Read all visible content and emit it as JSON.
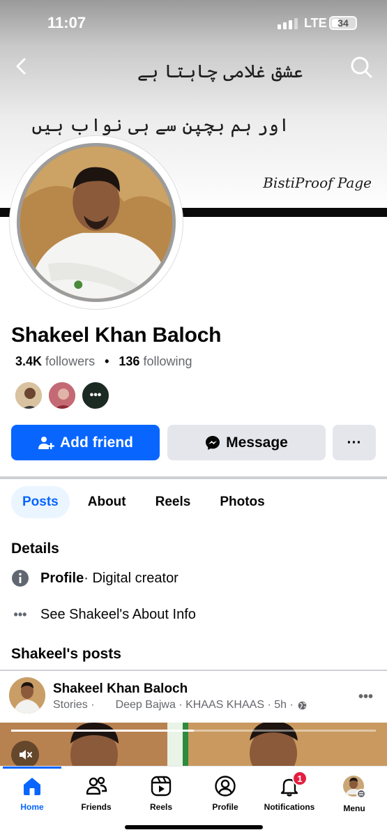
{
  "status_bar": {
    "time": "11:07",
    "network": "LTE",
    "battery": "34",
    "battery_fraction": 0.34
  },
  "cover": {
    "line1": "عشق غلامی چاہتا ہے",
    "line2": "اور ہم بچپن سے ہی نواب ہیں",
    "watermark": "BistiProof Page"
  },
  "profile": {
    "name": "Shakeel Khan Baloch",
    "followers_count": "3.4K",
    "followers_label": "followers",
    "following_count": "136",
    "following_label": "following"
  },
  "actions": {
    "add_friend": "Add friend",
    "message": "Message",
    "more": "···"
  },
  "tabs": [
    {
      "label": "Posts",
      "active": true
    },
    {
      "label": "About"
    },
    {
      "label": "Reels"
    },
    {
      "label": "Photos"
    }
  ],
  "details": {
    "title": "Details",
    "profile_label": "Profile",
    "profile_value": " · Digital creator",
    "see_about": "See Shakeel's About Info"
  },
  "posts": {
    "title": "Shakeel's posts",
    "post": {
      "author": "Shakeel Khan Baloch",
      "source": "Stories ·",
      "music": "Deep Bajwa · KHAAS KHAAS · 5h ·",
      "progress": 0.5
    }
  },
  "bottom_nav": [
    {
      "label": "Home",
      "icon": "home-icon",
      "active": true
    },
    {
      "label": "Friends",
      "icon": "friends-icon"
    },
    {
      "label": "Reels",
      "icon": "reels-icon"
    },
    {
      "label": "Profile",
      "icon": "profile-icon"
    },
    {
      "label": "Notifications",
      "icon": "bell-icon",
      "badge": "1"
    },
    {
      "label": "Menu",
      "icon": "menu-avatar-icon"
    }
  ],
  "colors": {
    "accent": "#0866ff",
    "secondary_button": "#e4e6eb",
    "badge": "#e41e3f",
    "muted_text": "#65676b"
  }
}
